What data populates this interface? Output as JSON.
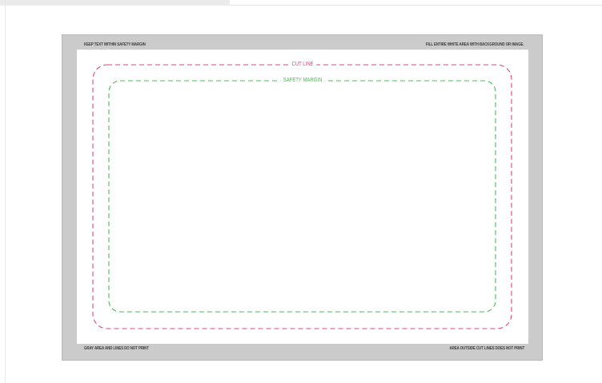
{
  "template": {
    "top_left_note": "KEEP TEXT WITHIN SAFETY MARGIN",
    "top_right_note": "FILL ENTIRE WHITE AREA WITH BACKGROUND OR IMAGE.",
    "bottom_left_note": "GRAY AREA AND LINES DO NOT PRINT",
    "bottom_right_note": "AREA OUTSIDE CUT LINES DOES NOT PRINT",
    "cut_line_label": "CUT LINE",
    "safety_margin_label": "SAFETY MARGIN"
  },
  "colors": {
    "cut_line": "#e0457b",
    "safety_margin": "#4cb85a",
    "bleed_area": "#cbcbcb"
  }
}
